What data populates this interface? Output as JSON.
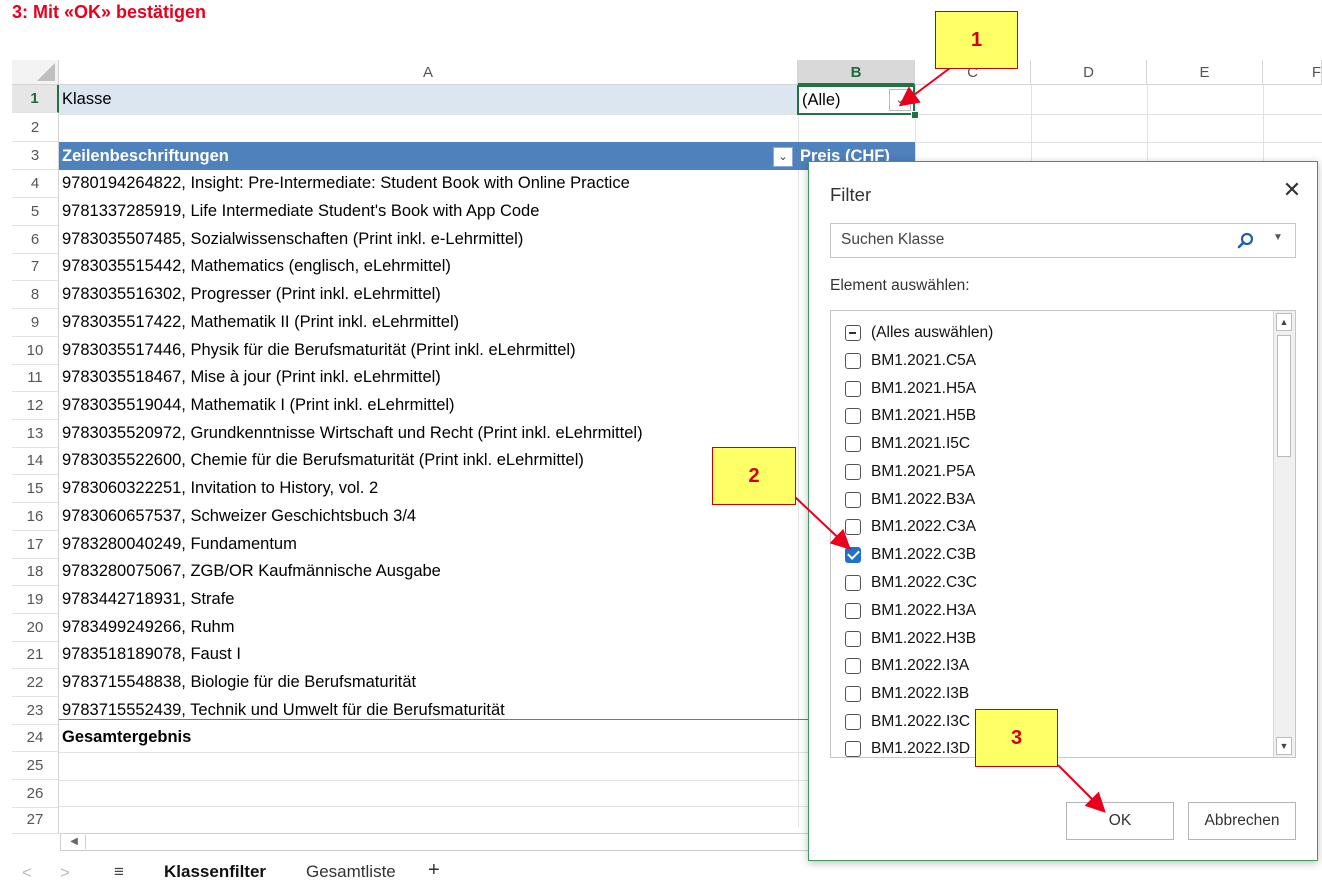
{
  "caption": "3: Mit «OK» bestätigen",
  "sheet": {
    "columns": [
      "A",
      "B",
      "C",
      "D",
      "E",
      "F"
    ],
    "row_numbers": [
      "1",
      "2",
      "3",
      "4",
      "5",
      "6",
      "7",
      "8",
      "9",
      "10",
      "11",
      "12",
      "13",
      "14",
      "15",
      "16",
      "17",
      "18",
      "19",
      "20",
      "21",
      "22",
      "23",
      "24",
      "25",
      "26",
      "27"
    ],
    "a1": "Klasse",
    "b1": "(Alle)",
    "header_a": "Zeilenbeschriftungen",
    "header_b": "Preis (CHF)",
    "rows": [
      "9780194264822, Insight: Pre-Intermediate: Student Book with Online Practice",
      "9781337285919, Life Intermediate Student's Book with App Code",
      "9783035507485, Sozialwissenschaften (Print inkl. e-Lehrmittel)",
      "9783035515442, Mathematics (englisch, eLehrmittel)",
      "9783035516302, Progresser (Print inkl. eLehrmittel)",
      "9783035517422, Mathematik II (Print inkl. eLehrmittel)",
      "9783035517446, Physik für die Berufsmaturität (Print inkl. eLehrmittel)",
      "9783035518467, Mise à jour (Print inkl. eLehrmittel)",
      "9783035519044, Mathematik I (Print inkl. eLehrmittel)",
      "9783035520972, Grundkenntnisse Wirtschaft und Recht (Print inkl. eLehrmittel)",
      "9783035522600, Chemie für die Berufsmaturität (Print inkl. eLehrmittel)",
      "9783060322251, Invitation to History, vol. 2",
      "9783060657537, Schweizer Geschichtsbuch 3/4",
      "9783280040249, Fundamentum",
      "9783280075067, ZGB/OR Kaufmännische Ausgabe",
      "9783442718931, Strafe",
      "9783499249266, Ruhm",
      "9783518189078, Faust I",
      "9783715548838, Biologie für die Berufsmaturität",
      "9783715552439, Technik und Umwelt für die Berufsmaturität"
    ],
    "total_label": "Gesamtergebnis"
  },
  "tabs": {
    "items": [
      "Klassenfilter",
      "Gesamtliste"
    ],
    "add": "+",
    "prev": "<",
    "next": ">",
    "menu": "≡"
  },
  "filter_dialog": {
    "title": "Filter",
    "close": "✕",
    "search_placeholder": "Suchen Klasse",
    "element_label": "Element auswählen:",
    "items": [
      {
        "label": "(Alles auswählen)",
        "state": "mixed"
      },
      {
        "label": "BM1.2021.C5A",
        "state": "unchecked"
      },
      {
        "label": "BM1.2021.H5A",
        "state": "unchecked"
      },
      {
        "label": "BM1.2021.H5B",
        "state": "unchecked"
      },
      {
        "label": "BM1.2021.I5C",
        "state": "unchecked"
      },
      {
        "label": "BM1.2021.P5A",
        "state": "unchecked"
      },
      {
        "label": "BM1.2022.B3A",
        "state": "unchecked"
      },
      {
        "label": "BM1.2022.C3A",
        "state": "unchecked"
      },
      {
        "label": "BM1.2022.C3B",
        "state": "checked"
      },
      {
        "label": "BM1.2022.C3C",
        "state": "unchecked"
      },
      {
        "label": "BM1.2022.H3A",
        "state": "unchecked"
      },
      {
        "label": "BM1.2022.H3B",
        "state": "unchecked"
      },
      {
        "label": "BM1.2022.I3A",
        "state": "unchecked"
      },
      {
        "label": "BM1.2022.I3B",
        "state": "unchecked"
      },
      {
        "label": "BM1.2022.I3C",
        "state": "unchecked"
      },
      {
        "label": "BM1.2022.I3D",
        "state": "unchecked"
      }
    ],
    "ok_label": "OK",
    "cancel_label": "Abbrechen"
  },
  "callouts": [
    "1",
    "2",
    "3"
  ],
  "colors": {
    "accent_green": "#217346",
    "pivot_header_blue": "#4f81bd",
    "callout_yellow": "#ffff66",
    "callout_red": "#d00000",
    "checkbox_blue": "#1f72c8"
  }
}
